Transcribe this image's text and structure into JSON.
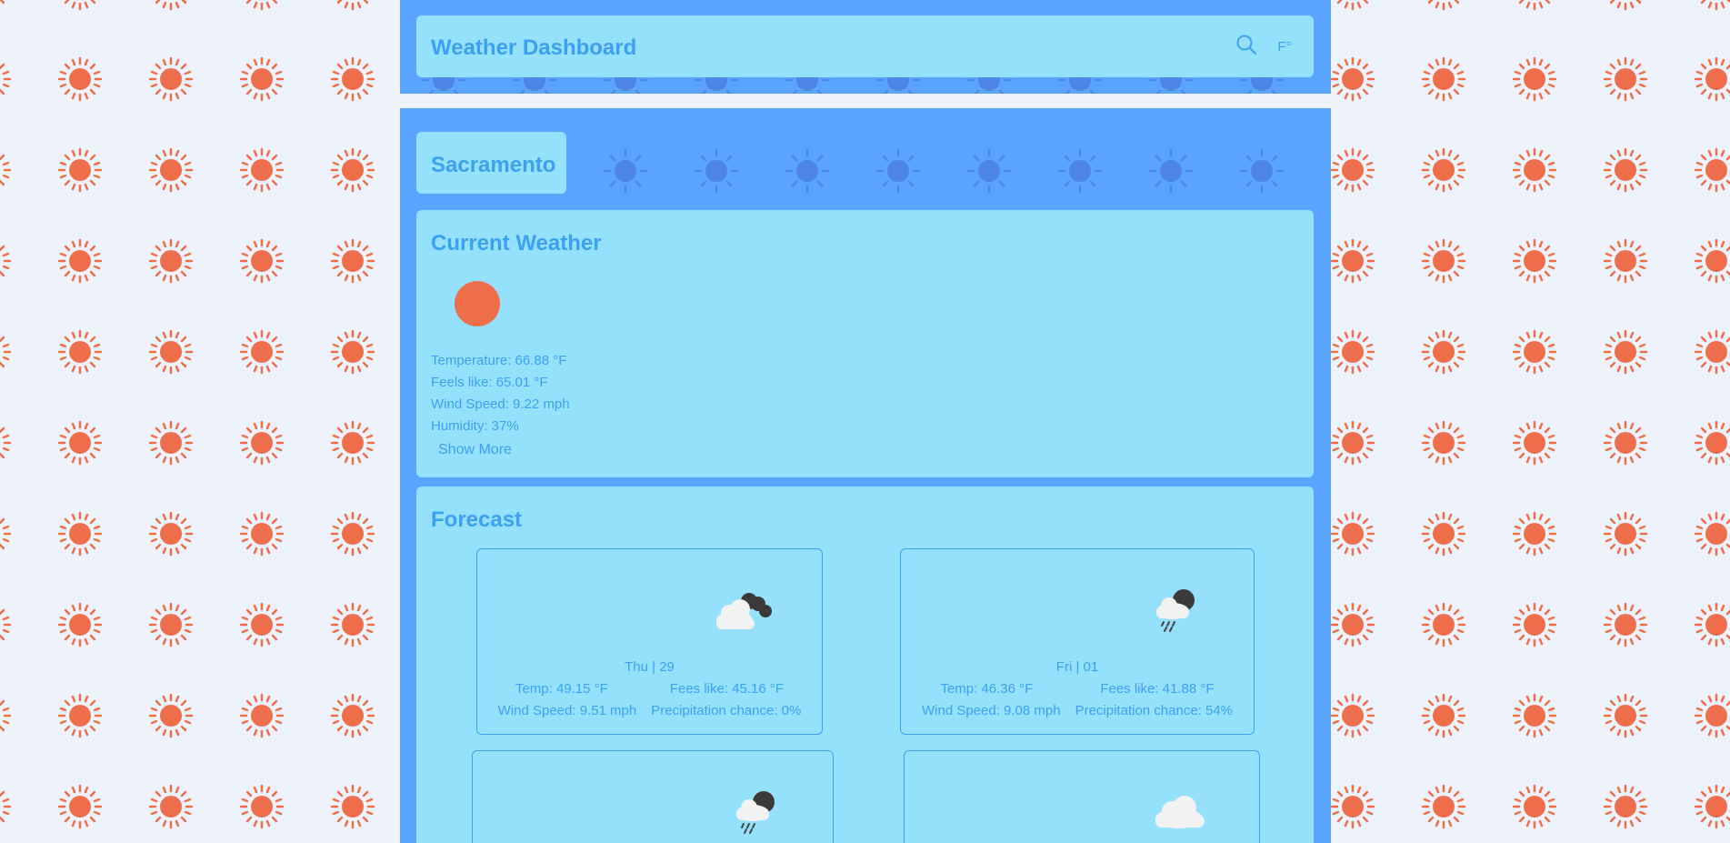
{
  "header": {
    "title": "Weather Dashboard",
    "unit_label": "F°"
  },
  "city": {
    "name": "Sacramento"
  },
  "current": {
    "title": "Current Weather",
    "temperature": "Temperature: 66.88 °F",
    "feels_like": "Feels like: 65.01 °F",
    "wind_speed": "Wind Speed: 9.22 mph",
    "humidity": "Humidity: 37%",
    "show_more": "Show More",
    "icon": "sun-icon"
  },
  "forecast": {
    "title": "Forecast",
    "days": [
      {
        "date": "Thu | 29",
        "temp": "Temp: 49.15 °F",
        "feels": "Fees like: 45.16 °F",
        "wind": "Wind Speed: 9.51 mph",
        "precip": "Precipitation chance: 0%",
        "icon": "cloudy-night-icon"
      },
      {
        "date": "Fri | 01",
        "temp": "Temp: 46.36 °F",
        "feels": "Fees like: 41.88 °F",
        "wind": "Wind Speed: 9.08 mph",
        "precip": "Precipitation chance: 54%",
        "icon": "rain-night-icon"
      },
      {
        "icon": "rain-night-icon"
      },
      {
        "icon": "cloud-icon"
      }
    ]
  },
  "colors": {
    "panel": "#5aa4ff",
    "card": "#94e0fd",
    "text": "#3d9ff2",
    "sun": "#ee6e4c",
    "background": "#eef3fb"
  }
}
